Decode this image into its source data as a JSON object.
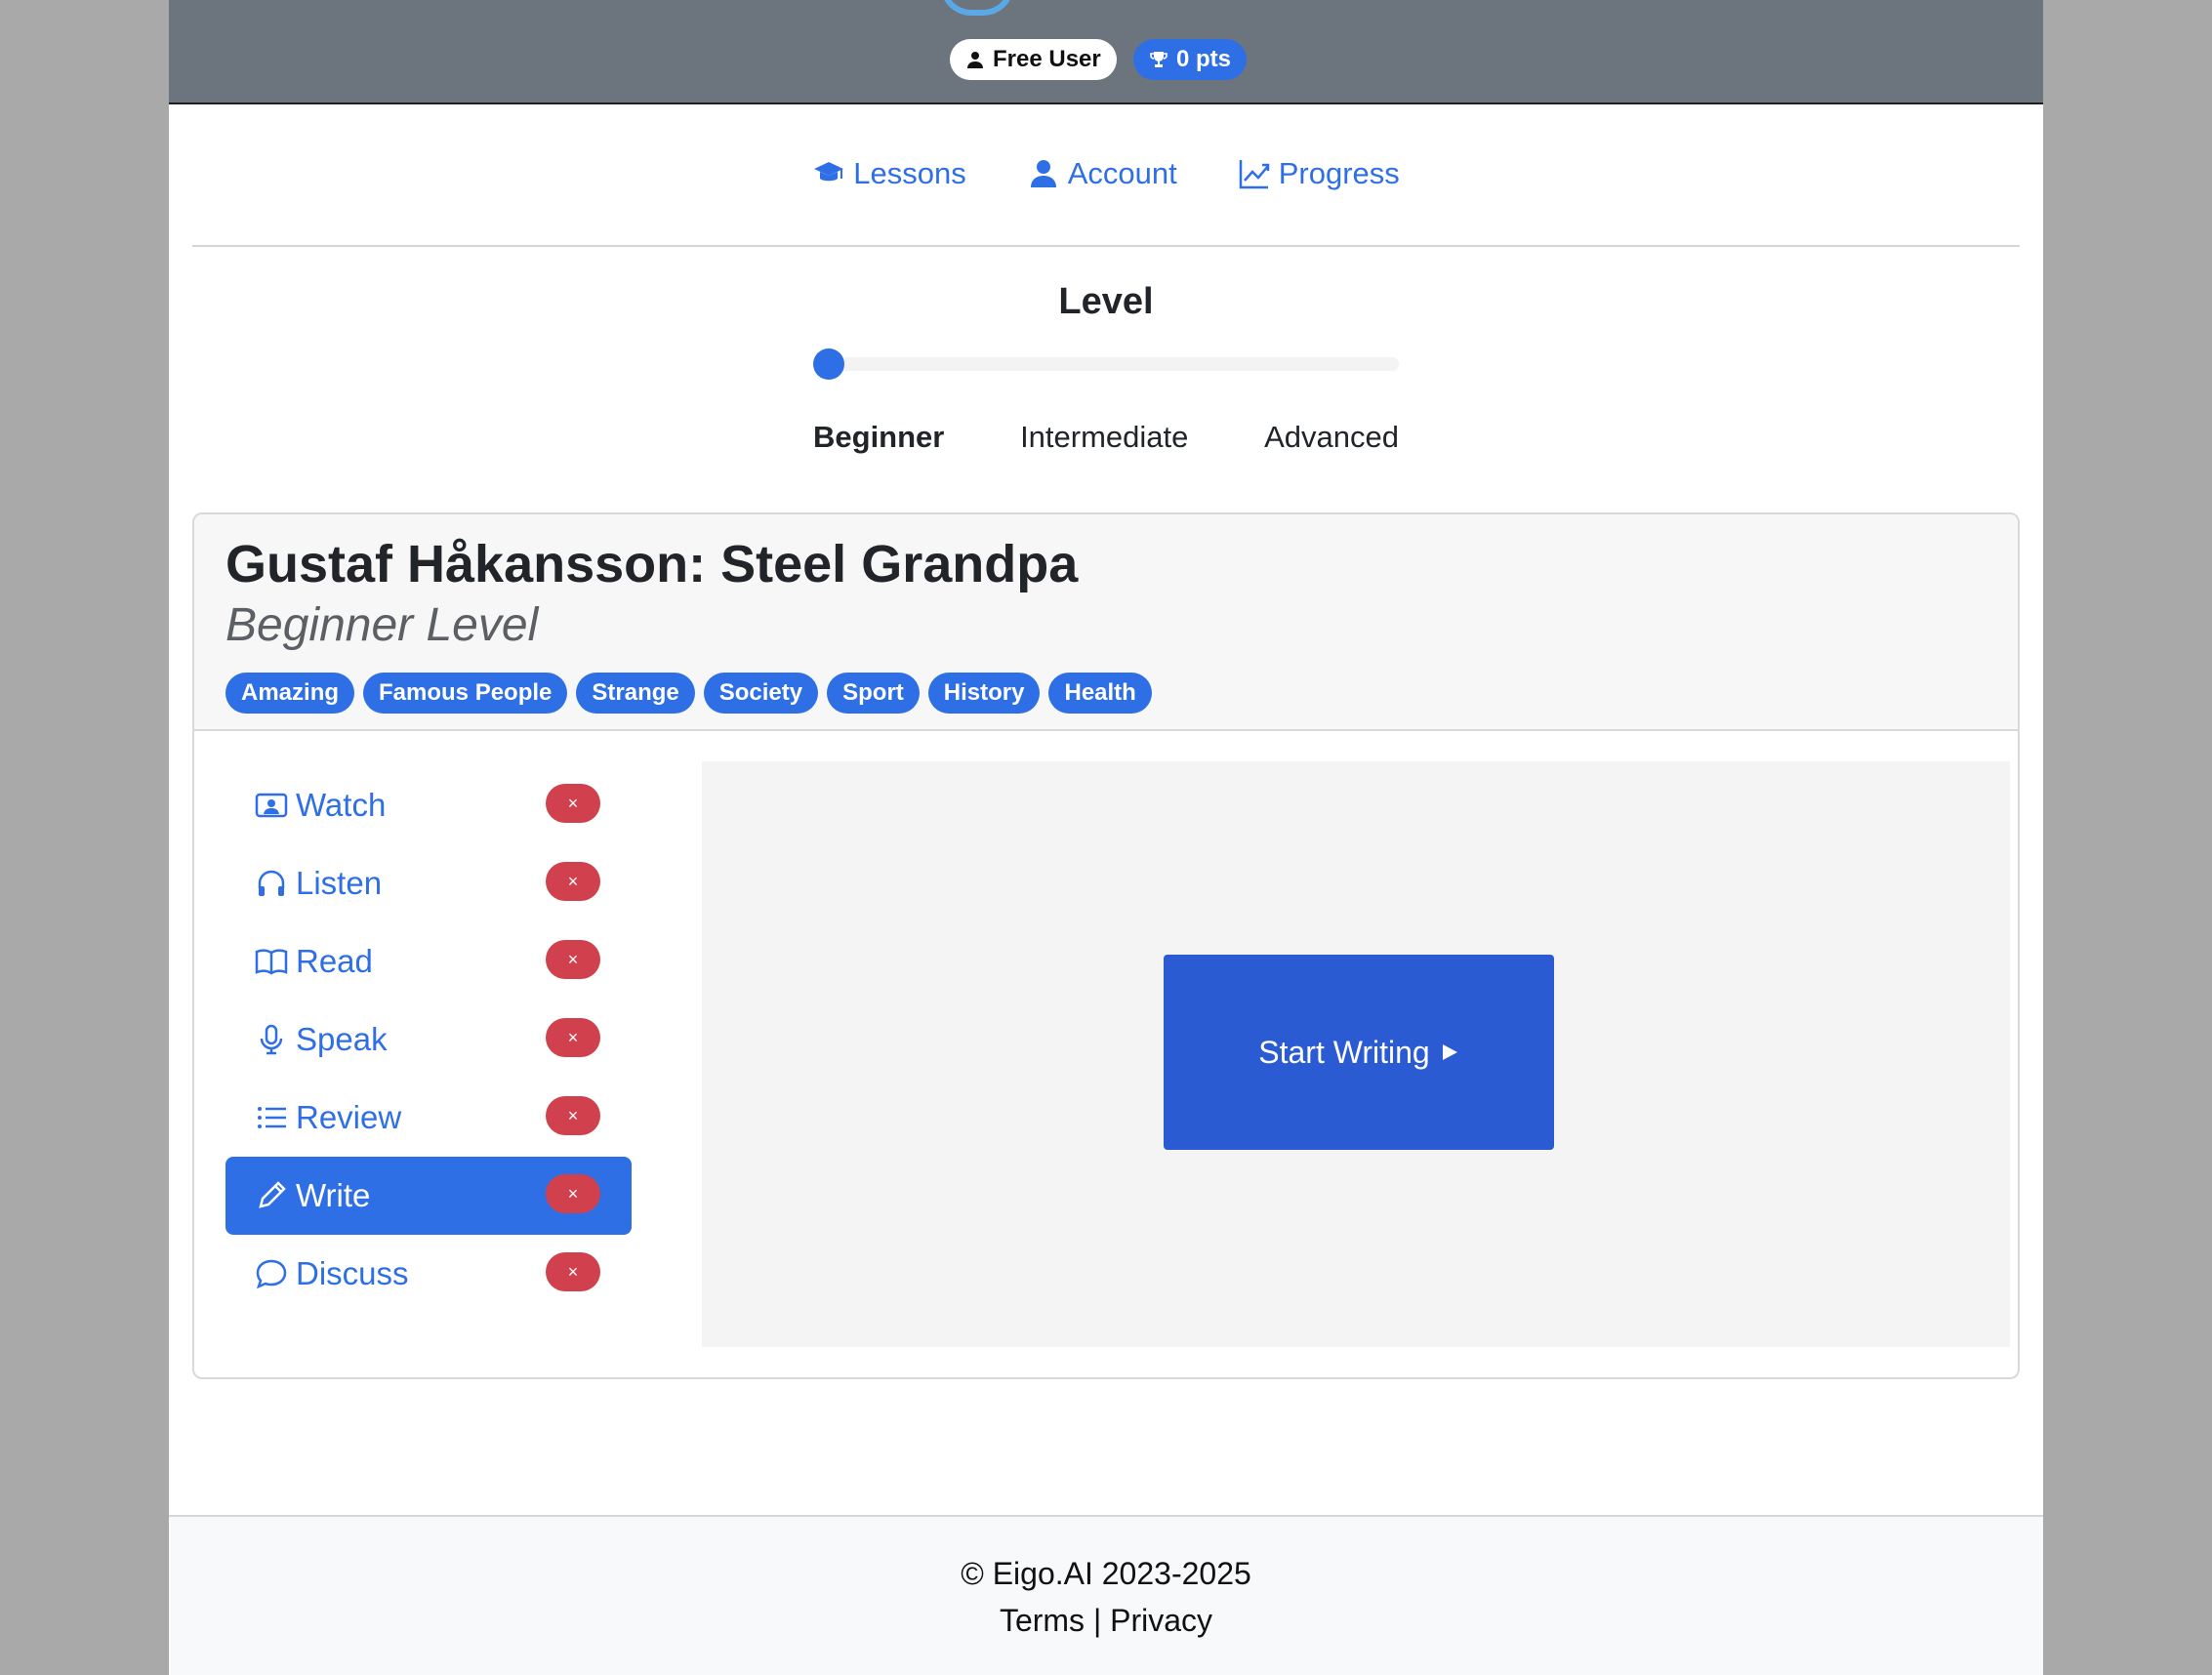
{
  "header": {
    "user_badge": "Free User",
    "points_badge": "0 pts"
  },
  "nav": {
    "items": [
      {
        "label": "Lessons",
        "icon": "graduation-cap-icon"
      },
      {
        "label": "Account",
        "icon": "user-icon"
      },
      {
        "label": "Progress",
        "icon": "chart-line-icon"
      }
    ]
  },
  "level": {
    "title": "Level",
    "options": [
      "Beginner",
      "Intermediate",
      "Advanced"
    ],
    "selected": "Beginner",
    "slider_value": 0
  },
  "lesson": {
    "title": "Gustaf Håkansson: Steel Grandpa",
    "subtitle": "Beginner Level",
    "tags": [
      "Amazing",
      "Famous People",
      "Strange",
      "Society",
      "Sport",
      "History",
      "Health"
    ]
  },
  "menu": {
    "items": [
      {
        "label": "Watch",
        "icon": "video-icon"
      },
      {
        "label": "Listen",
        "icon": "headphones-icon"
      },
      {
        "label": "Read",
        "icon": "book-icon"
      },
      {
        "label": "Speak",
        "icon": "microphone-icon"
      },
      {
        "label": "Review",
        "icon": "list-icon"
      },
      {
        "label": "Write",
        "icon": "pencil-icon",
        "active": true
      },
      {
        "label": "Discuss",
        "icon": "chat-icon"
      }
    ],
    "status_mark": "×"
  },
  "panel": {
    "button_label": "Start Writing"
  },
  "footer": {
    "copyright": "© Eigo.AI 2023-2025",
    "terms": "Terms",
    "separator": "|",
    "privacy": "Privacy"
  },
  "colors": {
    "accent": "#2f6fe6",
    "danger": "#d0404d",
    "header_bg": "#6c757d"
  }
}
